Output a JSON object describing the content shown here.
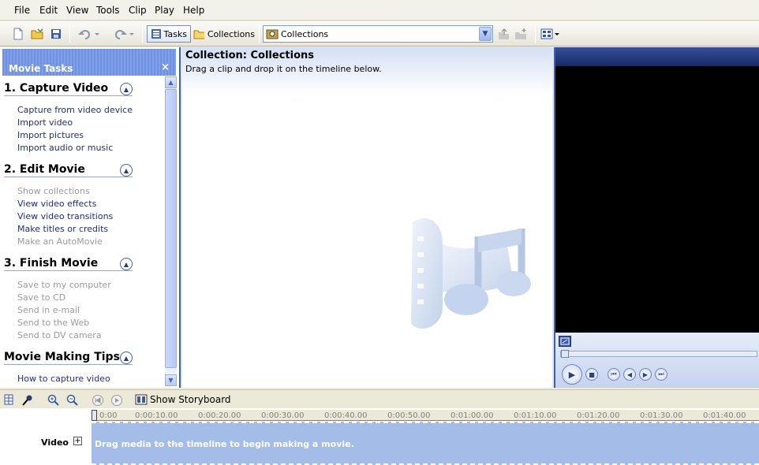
{
  "menu": [
    "File",
    "Edit",
    "View",
    "Tools",
    "Clip",
    "Play",
    "Help"
  ],
  "toolbar": {
    "tasks_label": "Tasks",
    "collections_label": "Collections",
    "combo_value": "Collections"
  },
  "movie_tasks": {
    "title": "Movie Tasks",
    "close": "×",
    "sections": [
      {
        "title": "1. Capture Video",
        "links": [
          {
            "label": "Capture from video device"
          },
          {
            "label": "Import video"
          },
          {
            "label": "Import pictures"
          },
          {
            "label": "Import audio or music"
          }
        ]
      },
      {
        "title": "2. Edit Movie",
        "links": [
          {
            "label": "Show collections"
          },
          {
            "label": "View video effects"
          },
          {
            "label": "View video transitions"
          },
          {
            "label": "Make titles or credits"
          },
          {
            "label": "Make an AutoMovie"
          }
        ]
      },
      {
        "title": "3. Finish Movie",
        "links": [
          {
            "label": "Save to my computer"
          },
          {
            "label": "Save to CD"
          },
          {
            "label": "Send in e-mail"
          },
          {
            "label": "Send to the Web"
          },
          {
            "label": "Send to DV camera"
          }
        ]
      },
      {
        "title": "Movie Making Tips",
        "links": [
          {
            "label": "How to capture video"
          }
        ]
      }
    ]
  },
  "collection": {
    "title": "Collection: Collections",
    "subtitle": "Drag a clip and drop it on the timeline below."
  },
  "timeline": {
    "show_storyboard": "Show Storyboard",
    "ruler": [
      "0:00",
      "0:00:10.00",
      "0:00:20.00",
      "0:00:30.00",
      "0:00:40.00",
      "0:00:50.00",
      "0:01:00.00",
      "0:01:10.00",
      "0:01:20.00",
      "0:01:30.00",
      "0:01:40.00"
    ],
    "track_label": "Video",
    "track_message": "Drag media to the timeline to begin making a movie."
  },
  "colors": {
    "panel_border": "#3e5fb6",
    "track": "#a3bce8",
    "link": "#1f2f7d",
    "disabled": "#9a9a9a"
  }
}
